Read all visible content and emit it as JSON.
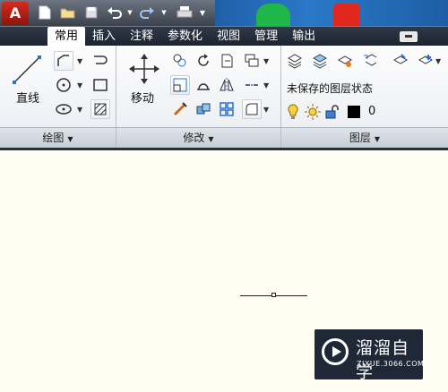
{
  "app": {
    "logo_text": "A"
  },
  "quick_access": [
    {
      "name": "new-icon"
    },
    {
      "name": "open-icon"
    },
    {
      "name": "save-icon"
    },
    {
      "name": "undo-icon"
    },
    {
      "name": "redo-icon"
    },
    {
      "name": "print-icon"
    }
  ],
  "tabs": [
    "常用",
    "插入",
    "注释",
    "参数化",
    "视图",
    "管理",
    "输出"
  ],
  "active_tab": "常用",
  "ribbon": {
    "draw_panel": {
      "title": "绘图",
      "line_label": "直线"
    },
    "modify_panel": {
      "title": "修改",
      "move_label": "移动"
    },
    "layers_panel": {
      "title": "图层",
      "layer_state": "未保存的图层状态",
      "current_layer": "0"
    }
  },
  "watermark": {
    "brand": "溜溜自学",
    "url": "ZIXUE.3066.COM"
  },
  "colors": {
    "canvas": "#fffdf2",
    "layer_color": "#000000"
  }
}
